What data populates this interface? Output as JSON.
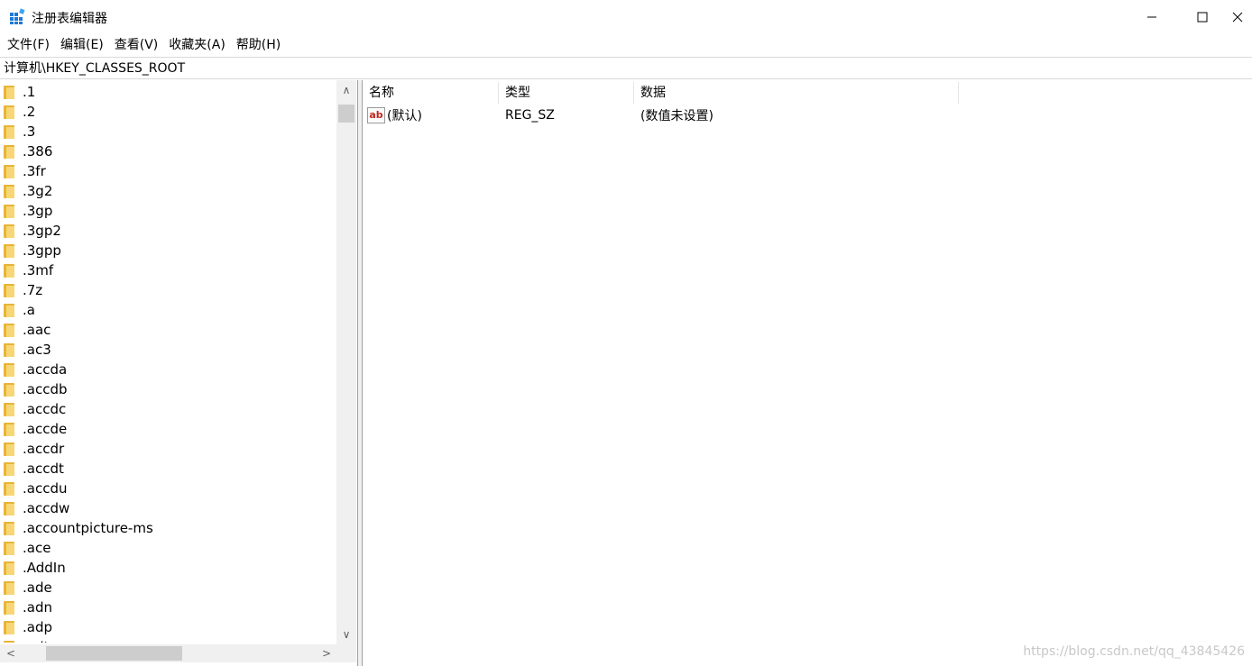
{
  "window": {
    "title": "注册表编辑器",
    "min_icon": "minimize-icon",
    "max_icon": "maximize-icon",
    "close_icon": "close-icon"
  },
  "menu": [
    {
      "label": "文件(F)"
    },
    {
      "label": "编辑(E)"
    },
    {
      "label": "查看(V)"
    },
    {
      "label": "收藏夹(A)"
    },
    {
      "label": "帮助(H)"
    }
  ],
  "address": "计算机\\HKEY_CLASSES_ROOT",
  "tree": {
    "items": [
      ".1",
      ".2",
      ".3",
      ".386",
      ".3fr",
      ".3g2",
      ".3gp",
      ".3gp2",
      ".3gpp",
      ".3mf",
      ".7z",
      ".a",
      ".aac",
      ".ac3",
      ".accda",
      ".accdb",
      ".accdc",
      ".accde",
      ".accdr",
      ".accdt",
      ".accdu",
      ".accdw",
      ".accountpicture-ms",
      ".ace",
      ".AddIn",
      ".ade",
      ".adn",
      ".adp",
      ".adt"
    ],
    "folder_icon": "folder-icon"
  },
  "values": {
    "columns": [
      "名称",
      "类型",
      "数据"
    ],
    "rows": [
      {
        "name": "(默认)",
        "type": "REG_SZ",
        "data": "(数值未设置)",
        "icon": "string-value-icon",
        "icon_text": "ab"
      }
    ]
  },
  "watermark": "https://blog.csdn.net/qq_43845426",
  "colors": {
    "folder": "#e8b437",
    "folder_light": "#f7d775",
    "string_icon_text": "#c0281e",
    "scrollbar_thumb": "#cdcdcd"
  }
}
